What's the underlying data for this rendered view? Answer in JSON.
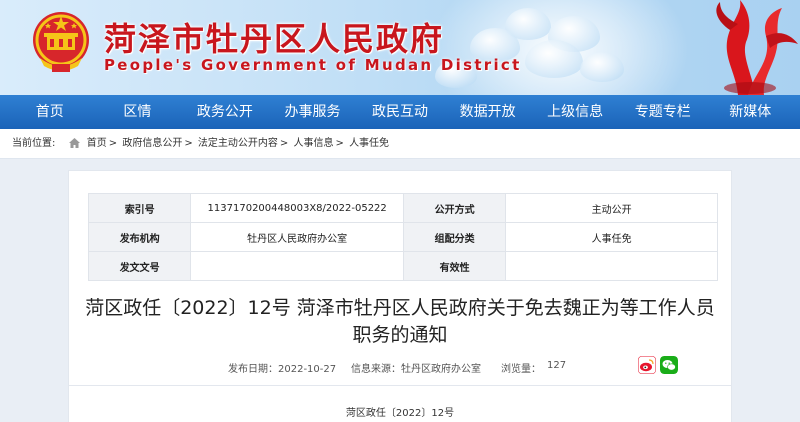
{
  "header": {
    "title": "菏泽市牡丹区人民政府",
    "subtitle": "People's Government of Mudan District"
  },
  "nav": [
    "首页",
    "区情",
    "政务公开",
    "办事服务",
    "政民互动",
    "数据开放",
    "上级信息",
    "专题专栏",
    "新媒体"
  ],
  "breadcrumb": {
    "label": "当前位置:",
    "items": [
      "首页",
      "政府信息公开",
      "法定主动公开内容",
      "人事信息",
      "人事任免"
    ],
    "separator": ">"
  },
  "meta": {
    "index_label": "索引号",
    "index_value": "1137170200448003X8/2022-05222",
    "disclosure_label": "公开方式",
    "disclosure_value": "主动公开",
    "publisher_label": "发布机构",
    "publisher_value": "牡丹区人民政府办公室",
    "category_label": "组配分类",
    "category_value": "人事任免",
    "docno_label": "发文文号",
    "docno_value": "",
    "validity_label": "有效性",
    "validity_value": ""
  },
  "document": {
    "title": "菏区政任〔2022〕12号 菏泽市牡丹区人民政府关于免去魏正为等工作人员职务的通知",
    "date": "发布日期：2022-10-27",
    "source": "信息来源：牡丹区政府办公室",
    "views_label": "浏览量：",
    "views": "127",
    "number": "菏区政任〔2022〕12号"
  },
  "colors": {
    "brand_red": "#c8161d",
    "nav_blue": "#1b63b8",
    "weibo": "#e6162d",
    "wechat": "#1aad19"
  },
  "icons": [
    "national-emblem-icon",
    "home-icon",
    "weibo-icon",
    "wechat-icon"
  ]
}
